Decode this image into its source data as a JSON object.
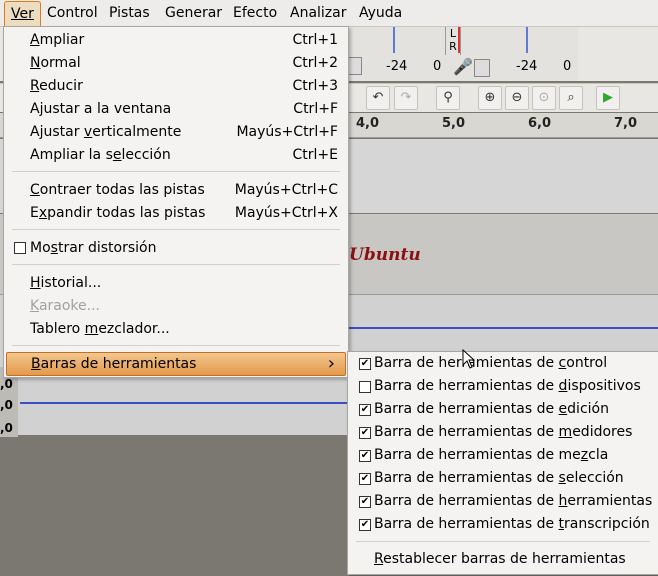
{
  "menubar": [
    "Ver",
    "Control",
    "Pistas",
    "Generar",
    "Efecto",
    "Analizar",
    "Ayuda"
  ],
  "meters": {
    "left_value": "-24",
    "left_zero": "0",
    "right_value": "-24",
    "right_zero": "0",
    "channel_l": "L",
    "channel_r": "R"
  },
  "ruler": [
    "4,0",
    "5,0",
    "6,0",
    "7,0"
  ],
  "track_labels": [
    ",0",
    ",0",
    ",0"
  ],
  "watermark": "Versión Ubuntu",
  "menu": {
    "items": [
      {
        "pre": "",
        "ul": "A",
        "post": "mpliar",
        "shortcut": "Ctrl+1"
      },
      {
        "pre": "",
        "ul": "N",
        "post": "ormal",
        "shortcut": "Ctrl+2"
      },
      {
        "pre": "",
        "ul": "R",
        "post": "educir",
        "shortcut": "Ctrl+3"
      },
      {
        "pre": "A",
        "ul": "j",
        "post": "ustar a la ventana",
        "shortcut": "Ctrl+F"
      },
      {
        "pre": "Ajustar ",
        "ul": "v",
        "post": "erticalmente",
        "shortcut": "Mayús+Ctrl+F"
      },
      {
        "pre": "Ampliar la s",
        "ul": "e",
        "post": "lección",
        "shortcut": "Ctrl+E"
      },
      {
        "pre": "",
        "ul": "C",
        "post": "ontraer todas las pistas",
        "shortcut": "Mayús+Ctrl+C"
      },
      {
        "pre": "E",
        "ul": "x",
        "post": "pandir todas las pistas",
        "shortcut": "Mayús+Ctrl+X"
      },
      {
        "pre": "Mo",
        "ul": "s",
        "post": "trar distorsión",
        "shortcut": ""
      },
      {
        "pre": "",
        "ul": "H",
        "post": "istorial...",
        "shortcut": ""
      },
      {
        "pre": "",
        "ul": "K",
        "post": "araoke...",
        "shortcut": ""
      },
      {
        "pre": "Tablero ",
        "ul": "m",
        "post": "ezclador...",
        "shortcut": ""
      },
      {
        "pre": "",
        "ul": "B",
        "post": "arras de herramientas",
        "shortcut": ""
      }
    ],
    "submenu_arrow": "›"
  },
  "submenu": {
    "items": [
      {
        "pre": "Barra de herramientas de ",
        "ul": "c",
        "post": "ontrol",
        "checked": true
      },
      {
        "pre": "Barra de herramientas de ",
        "ul": "d",
        "post": "ispositivos",
        "checked": false
      },
      {
        "pre": "Barra de herramientas de ",
        "ul": "e",
        "post": "dición",
        "checked": true
      },
      {
        "pre": "Barra de herramientas de ",
        "ul": "m",
        "post": "edidores",
        "checked": true
      },
      {
        "pre": "Barra de herramientas de me",
        "ul": "z",
        "post": "cla",
        "checked": true
      },
      {
        "pre": "Barra de herramientas de ",
        "ul": "s",
        "post": "elección",
        "checked": true
      },
      {
        "pre": "Barra de herramientas de ",
        "ul": "h",
        "post": "erramientas",
        "checked": true
      },
      {
        "pre": "Barra de herramientas de ",
        "ul": "t",
        "post": "ranscripción",
        "checked": true
      },
      {
        "pre": "",
        "ul": "R",
        "post": "establecer barras de herramientas",
        "checked": null
      }
    ]
  }
}
